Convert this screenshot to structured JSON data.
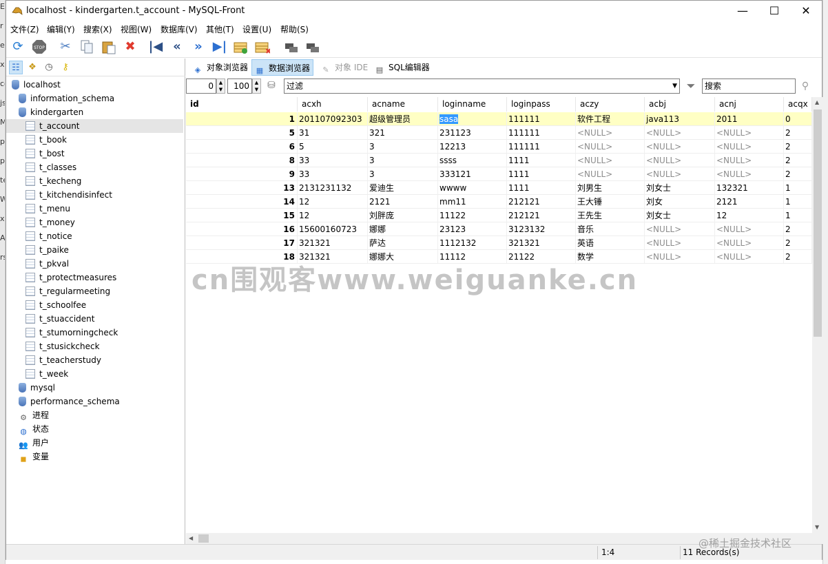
{
  "window": {
    "title": "localhost - kindergarten.t_account - MySQL-Front",
    "minimize": "—",
    "maximize": "☐",
    "close": "✕"
  },
  "background_strip": [
    "Ex",
    "r",
    "eb",
    "x-",
    "co",
    "js",
    "M",
    "p",
    "p",
    "te",
    "W",
    "x",
    "A",
    "rs"
  ],
  "menu": [
    "文件(Z)",
    "编辑(Y)",
    "搜索(X)",
    "视图(W)",
    "数据库(V)",
    "其他(T)",
    "设置(U)",
    "帮助(S)"
  ],
  "toolbar": {
    "icons": [
      "refresh-icon",
      "stop-icon",
      "cut-icon",
      "copy-icon",
      "paste-icon",
      "delete-icon",
      "first-icon",
      "prev-icon",
      "next-icon",
      "last-icon",
      "insert-record-icon",
      "delete-record-icon",
      "commit-icon",
      "rollback-icon"
    ]
  },
  "tree": {
    "items": [
      {
        "label": "localhost",
        "level": 0,
        "kind": "server"
      },
      {
        "label": "information_schema",
        "level": 1,
        "kind": "db"
      },
      {
        "label": "kindergarten",
        "level": 1,
        "kind": "db"
      },
      {
        "label": "t_account",
        "level": 2,
        "kind": "table",
        "selected": true
      },
      {
        "label": "t_book",
        "level": 2,
        "kind": "table"
      },
      {
        "label": "t_bost",
        "level": 2,
        "kind": "table"
      },
      {
        "label": "t_classes",
        "level": 2,
        "kind": "table"
      },
      {
        "label": "t_kecheng",
        "level": 2,
        "kind": "table"
      },
      {
        "label": "t_kitchendisinfect",
        "level": 2,
        "kind": "table"
      },
      {
        "label": "t_menu",
        "level": 2,
        "kind": "table"
      },
      {
        "label": "t_money",
        "level": 2,
        "kind": "table"
      },
      {
        "label": "t_notice",
        "level": 2,
        "kind": "table"
      },
      {
        "label": "t_paike",
        "level": 2,
        "kind": "table"
      },
      {
        "label": "t_pkval",
        "level": 2,
        "kind": "table"
      },
      {
        "label": "t_protectmeasures",
        "level": 2,
        "kind": "table"
      },
      {
        "label": "t_regularmeeting",
        "level": 2,
        "kind": "table"
      },
      {
        "label": "t_schoolfee",
        "level": 2,
        "kind": "table"
      },
      {
        "label": "t_stuaccident",
        "level": 2,
        "kind": "table"
      },
      {
        "label": "t_stumorningcheck",
        "level": 2,
        "kind": "table"
      },
      {
        "label": "t_stusickcheck",
        "level": 2,
        "kind": "table"
      },
      {
        "label": "t_teacherstudy",
        "level": 2,
        "kind": "table"
      },
      {
        "label": "t_week",
        "level": 2,
        "kind": "table"
      },
      {
        "label": "mysql",
        "level": 1,
        "kind": "db"
      },
      {
        "label": "performance_schema",
        "level": 1,
        "kind": "db"
      },
      {
        "label": "进程",
        "level": 1,
        "kind": "process"
      },
      {
        "label": "状态",
        "level": 1,
        "kind": "status"
      },
      {
        "label": "用户",
        "level": 1,
        "kind": "users"
      },
      {
        "label": "变量",
        "level": 1,
        "kind": "variables"
      }
    ]
  },
  "tabs": [
    {
      "label": "对象浏览器",
      "icon": "object-browser-icon"
    },
    {
      "label": "数据浏览器",
      "icon": "data-browser-icon",
      "active": true
    },
    {
      "label": "对象 IDE",
      "icon": "object-ide-icon",
      "disabled": true
    },
    {
      "label": "SQL编辑器",
      "icon": "sql-editor-icon"
    }
  ],
  "filter": {
    "offset": "0",
    "limit": "100",
    "filter_placeholder": "过滤",
    "search_placeholder": "搜索"
  },
  "grid": {
    "columns": [
      "id",
      "acxh",
      "acname",
      "loginname",
      "loginpass",
      "aczy",
      "acbj",
      "acnj",
      "acqx"
    ],
    "rows": [
      [
        "1",
        "201107092303",
        "超级管理员",
        "sasa",
        "111111",
        "软件工程",
        "java113",
        "2011",
        "0"
      ],
      [
        "5",
        "31",
        "321",
        "231123",
        "111111",
        "<NULL>",
        "<NULL>",
        "<NULL>",
        "2"
      ],
      [
        "6",
        "5",
        "3",
        "12213",
        "111111",
        "<NULL>",
        "<NULL>",
        "<NULL>",
        "2"
      ],
      [
        "8",
        "33",
        "3",
        "ssss",
        "1111",
        "<NULL>",
        "<NULL>",
        "<NULL>",
        "2"
      ],
      [
        "9",
        "33",
        "3",
        "333121",
        "1111",
        "<NULL>",
        "<NULL>",
        "<NULL>",
        "2"
      ],
      [
        "13",
        "2131231132",
        "爱迪生",
        "wwww",
        "1111",
        "刘男生",
        "刘女士",
        "132321",
        "1"
      ],
      [
        "14",
        "12",
        "2121",
        "mm11",
        "212121",
        "王大锤",
        "刘女",
        "2121",
        "1"
      ],
      [
        "15",
        "12",
        "刘胖庞",
        "11122",
        "212121",
        "王先生",
        "刘女士",
        "12",
        "1"
      ],
      [
        "16",
        "15600160723",
        "娜娜",
        "23123",
        "3123132",
        "音乐",
        "<NULL>",
        "<NULL>",
        "2"
      ],
      [
        "17",
        "321321",
        "萨达",
        "1112132",
        "321321",
        "英语",
        "<NULL>",
        "<NULL>",
        "2"
      ],
      [
        "18",
        "321321",
        "娜娜大",
        "11112",
        "21122",
        "数学",
        "<NULL>",
        "<NULL>",
        "2"
      ]
    ]
  },
  "status": {
    "position": "1:4",
    "records": "11 Records(s)"
  },
  "watermark": "cn围观客www.weiguanke.cn",
  "corner_watermark": "@稀土掘金技术社区"
}
